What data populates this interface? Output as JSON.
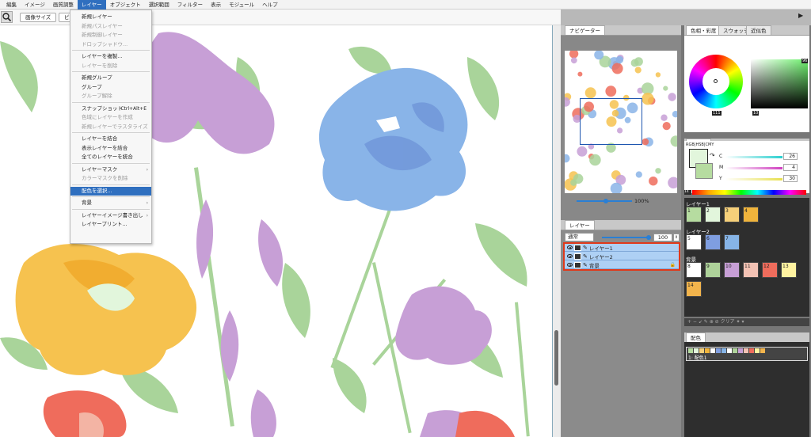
{
  "menubar": {
    "items": [
      "編集",
      "イメージ",
      "画質調整",
      "レイヤー",
      "オブジェクト",
      "選択範囲",
      "フィルター",
      "表示",
      "モジュール",
      "ヘルプ"
    ],
    "active_index": 3
  },
  "toolbar": {
    "btn1": "画像サイズ",
    "btn2": "ピ"
  },
  "layer_menu": {
    "items": [
      {
        "label": "新規レイヤー",
        "disabled": false
      },
      {
        "label": "新規パスレイヤー",
        "disabled": true
      },
      {
        "label": "新規制御レイヤー",
        "disabled": true
      },
      {
        "label": "ドロップシャドウ...",
        "disabled": true
      },
      {
        "label": "レイヤーを複製...",
        "disabled": false
      },
      {
        "label": "レイヤーを削除",
        "disabled": true
      },
      {
        "label": "新規グループ",
        "disabled": false
      },
      {
        "label": "グループ",
        "disabled": false
      },
      {
        "label": "グループ解除",
        "disabled": true
      },
      {
        "label": "スナップショット",
        "shortcut": "Ctrl+Alt+E",
        "disabled": false
      },
      {
        "label": "色域にレイヤーを作成",
        "disabled": true
      },
      {
        "label": "新規レイヤーでラスタライズ",
        "disabled": true
      },
      {
        "label": "レイヤーを結合",
        "disabled": false
      },
      {
        "label": "表示レイヤーを結合",
        "disabled": false
      },
      {
        "label": "全てのレイヤーを統合",
        "disabled": false
      },
      {
        "label": "レイヤーマスク",
        "disabled": false,
        "submenu": true
      },
      {
        "label": "カラーマスクを削除",
        "disabled": true
      },
      {
        "label": "配色を選択...",
        "disabled": false,
        "selected": true
      },
      {
        "label": "背景",
        "disabled": false,
        "submenu": true
      },
      {
        "label": "レイヤーイメージ書き出し",
        "disabled": false,
        "submenu": true
      },
      {
        "label": "レイヤープリント...",
        "disabled": false
      }
    ]
  },
  "navigator": {
    "tab": "ナビゲーター",
    "zoom": "100%"
  },
  "layers": {
    "tab": "レイヤー",
    "blend": "通常",
    "opacity": "100",
    "rows": [
      {
        "name": "レイヤー1"
      },
      {
        "name": "レイヤー2"
      },
      {
        "name": "背景",
        "locked": true
      }
    ]
  },
  "color_panel": {
    "tabs": [
      "色相・彩度",
      "スウォッチ",
      "近似色"
    ],
    "sq_label": "96",
    "wheel_label": "111",
    "bottom_label": "10"
  },
  "cmy": {
    "tab": "カラー",
    "mode": "RGB|HSB|CMY",
    "c": "26",
    "m": "4",
    "y": "30",
    "extra": "14"
  },
  "swatches": {
    "groups": [
      {
        "name": "レイヤー1",
        "items": [
          {
            "n": "1",
            "color": "#b6dca0"
          },
          {
            "n": "2",
            "color": "#e2f6dc"
          },
          {
            "n": "3",
            "color": "#f6d07a"
          },
          {
            "n": "4",
            "color": "#f0b43c"
          }
        ]
      },
      {
        "name": "レイヤー2",
        "items": [
          {
            "n": "5",
            "color": "#ffffff"
          },
          {
            "n": "6",
            "color": "#7f9ee0"
          },
          {
            "n": "7",
            "color": "#86b4e6"
          }
        ]
      },
      {
        "name": "背景",
        "items": [
          {
            "n": "8",
            "color": "#ffffff"
          },
          {
            "n": "9",
            "color": "#aed29a"
          },
          {
            "n": "10",
            "color": "#c79fd6"
          },
          {
            "n": "11",
            "color": "#f3c2b4"
          },
          {
            "n": "12",
            "color": "#ef6c5c"
          },
          {
            "n": "13",
            "color": "#fff3a0"
          },
          {
            "n": "14",
            "color": "#f2b44c"
          }
        ]
      }
    ],
    "clear": "クリア"
  },
  "palette": {
    "tab": "配色",
    "item": "1: 配色1"
  }
}
